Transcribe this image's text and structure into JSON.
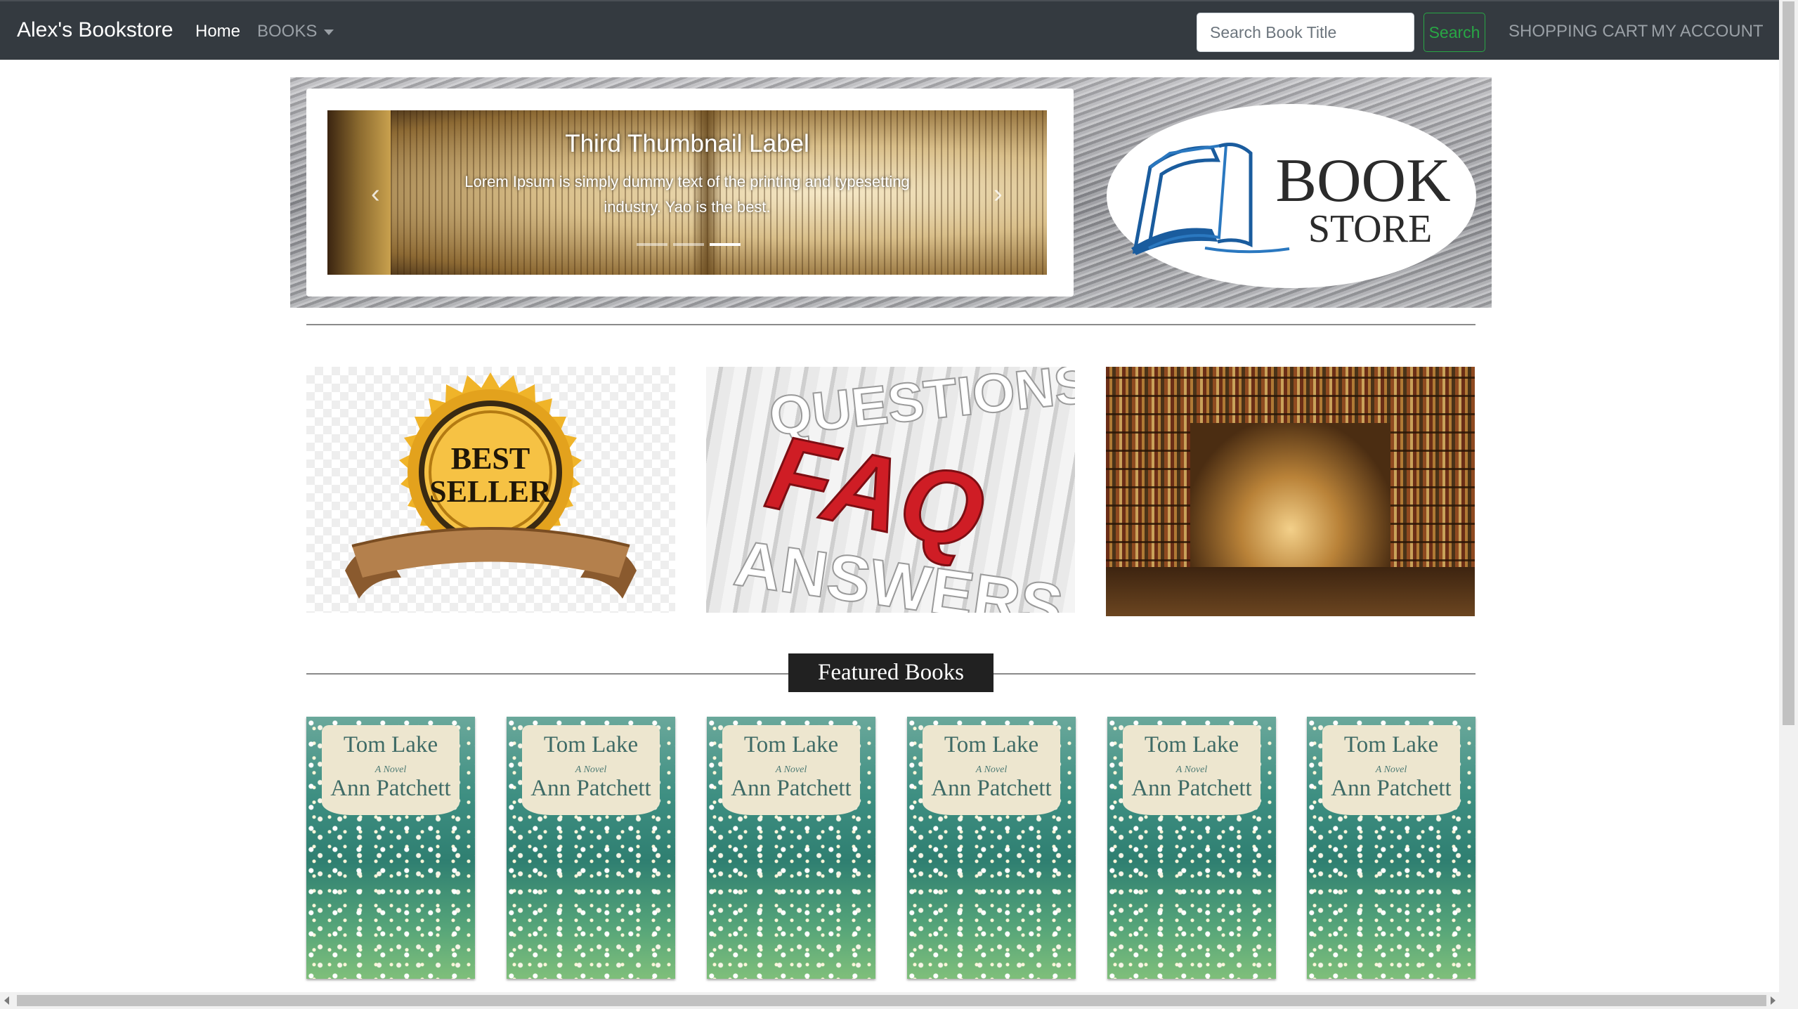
{
  "navbar": {
    "brand": "Alex's Bookstore",
    "home": "Home",
    "books": "BOOKS",
    "search_placeholder": "Search Book Title",
    "search_button": "Search",
    "cart": "SHOPPING CART",
    "account": "MY ACCOUNT"
  },
  "carousel": {
    "caption_title": "Third Thumbnail Label",
    "caption_text": "Lorem Ipsum is simply dummy text of the printing and typesetting industry. Yao is the best.",
    "prev_glyph": "‹",
    "next_glyph": "›",
    "slide_count": 3,
    "active_slide": 3
  },
  "logo": {
    "line1": "BOOK",
    "line2": "STORE"
  },
  "promo": {
    "best_seller_line1": "BEST",
    "best_seller_line2": "SELLER",
    "faq_text": "FAQ",
    "faq_back1": "QUESTIONS",
    "faq_back2": "ANSWERS"
  },
  "featured": {
    "heading": "Featured Books",
    "books": [
      {
        "title": "Tom Lake",
        "subtitle": "A Novel",
        "author": "Ann Patchett"
      },
      {
        "title": "Tom Lake",
        "subtitle": "A Novel",
        "author": "Ann Patchett"
      },
      {
        "title": "Tom Lake",
        "subtitle": "A Novel",
        "author": "Ann Patchett"
      },
      {
        "title": "Tom Lake",
        "subtitle": "A Novel",
        "author": "Ann Patchett"
      },
      {
        "title": "Tom Lake",
        "subtitle": "A Novel",
        "author": "Ann Patchett"
      },
      {
        "title": "Tom Lake",
        "subtitle": "A Novel",
        "author": "Ann Patchett"
      }
    ]
  },
  "colors": {
    "navbar_bg": "#343a40",
    "search_green": "#28a745",
    "featured_label_bg": "#212121"
  }
}
